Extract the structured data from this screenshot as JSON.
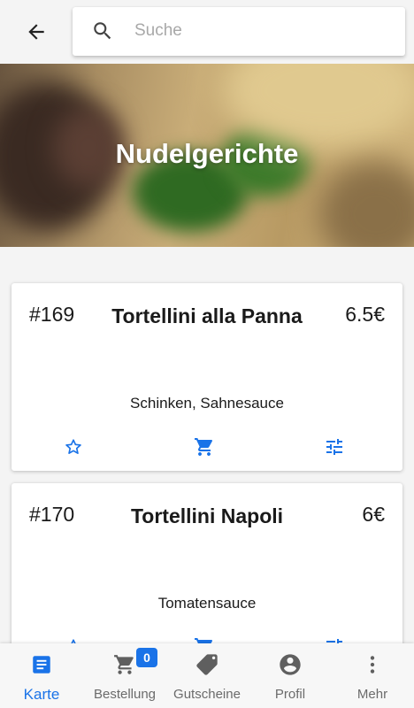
{
  "search": {
    "placeholder": "Suche"
  },
  "hero": {
    "title": "Nudelgerichte"
  },
  "menu_items": [
    {
      "number": "#169",
      "name": "Tortellini alla Panna",
      "price": "6.5€",
      "description": "Schinken, Sahnesauce"
    },
    {
      "number": "#170",
      "name": "Tortellini Napoli",
      "price": "6€",
      "description": "Tomatensauce"
    }
  ],
  "bottom_nav": {
    "items": [
      {
        "label": "Karte",
        "icon": "menu-card-icon",
        "active": true
      },
      {
        "label": "Bestellung",
        "icon": "cart-icon",
        "badge": "0"
      },
      {
        "label": "Gutscheine",
        "icon": "tag-icon"
      },
      {
        "label": "Profil",
        "icon": "account-circle-icon"
      },
      {
        "label": "Mehr",
        "icon": "more-vertical-icon"
      }
    ]
  },
  "colors": {
    "accent": "#1a73e8",
    "background": "#f4f4f4",
    "card": "#ffffff"
  }
}
